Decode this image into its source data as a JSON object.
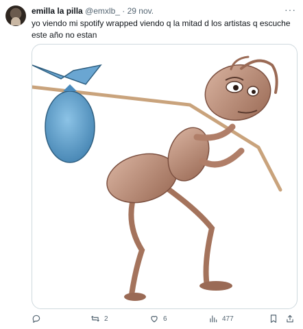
{
  "tweet": {
    "author_name": "emilla la pilla",
    "handle": "@emxlb_",
    "separator": "·",
    "date": "29 nov.",
    "text": "yo viendo mi spotify wrapped viendo q la mitad d los artistas q escuche este año no estan",
    "more_label": "···"
  },
  "actions": {
    "replies": "",
    "retweets": "2",
    "likes": "6",
    "views": "477"
  },
  "icons": {
    "reply": "reply-icon",
    "retweet": "retweet-icon",
    "like": "heart-icon",
    "views": "views-icon",
    "bookmark": "bookmark-icon"
  },
  "colors": {
    "text": "#0f1419",
    "muted": "#536471",
    "border": "#cfd9de",
    "bundle_blue": "#5b9bc8",
    "ant_brown": "#b98a72"
  }
}
